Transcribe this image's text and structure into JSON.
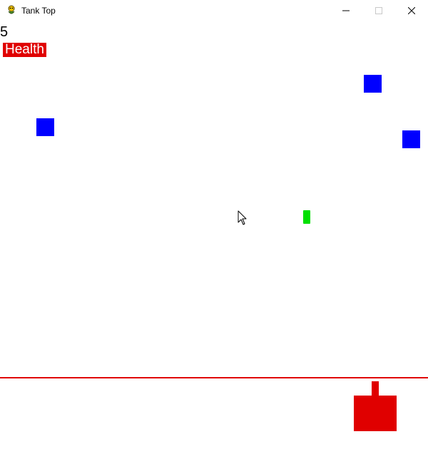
{
  "window": {
    "title": "Tank Top",
    "icons": {
      "app": "pygame-snake-icon",
      "minimize": "minimize-icon",
      "maximize": "maximize-icon",
      "close": "close-icon"
    }
  },
  "hud": {
    "score": "5",
    "health_label": "Health",
    "health_fraction": 1.0
  },
  "colors": {
    "background": "#ffffff",
    "enemy": "#0000ff",
    "bullet": "#00e000",
    "player": "#e00000",
    "ground_line": "#e00000",
    "health_bar": "#e00000"
  },
  "entities": {
    "enemies": [
      "enemy-block",
      "enemy-block",
      "enemy-block"
    ],
    "bullet": "bullet",
    "player": "player-tank"
  }
}
